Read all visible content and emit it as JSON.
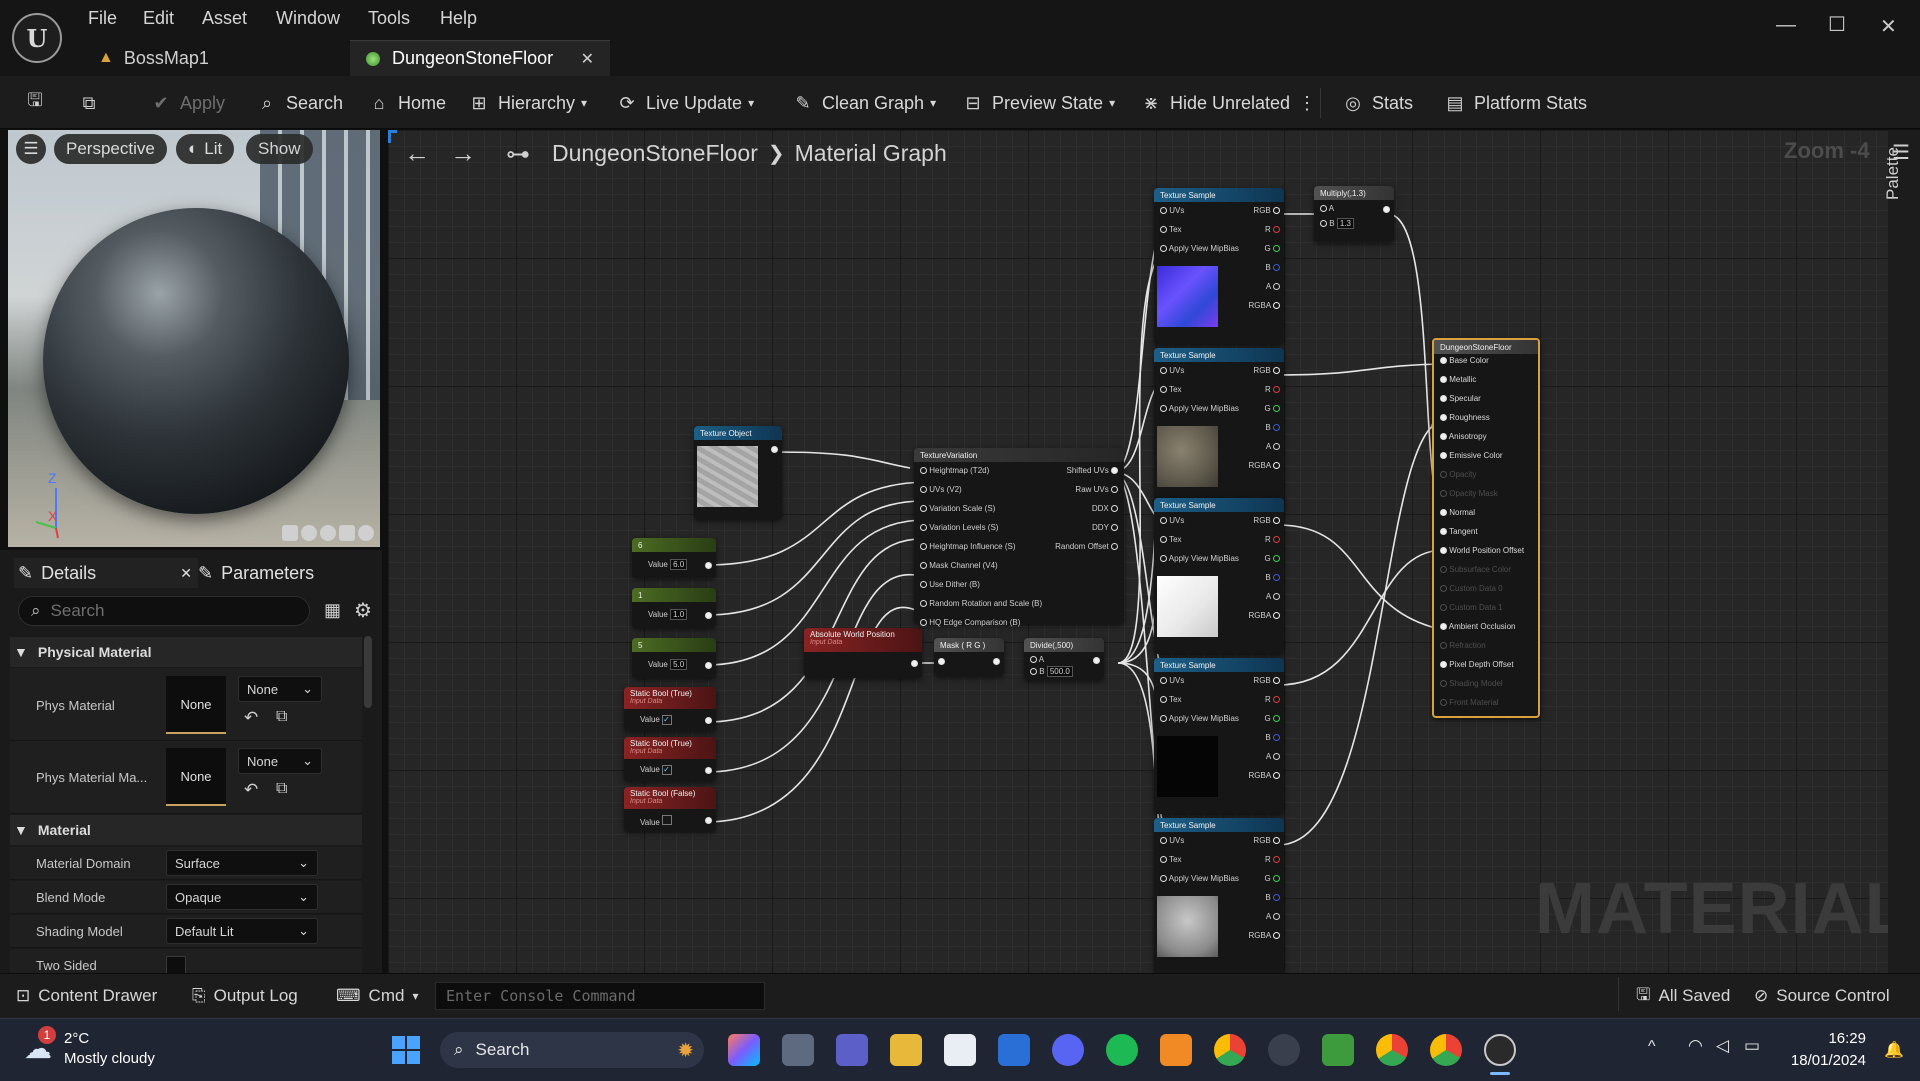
{
  "app": {
    "logo_text": "U",
    "menu": [
      "File",
      "Edit",
      "Asset",
      "Window",
      "Tools",
      "Help"
    ],
    "tabs": [
      {
        "label": "BossMap1",
        "active": false
      },
      {
        "label": "DungeonStoneFloor",
        "active": true
      }
    ]
  },
  "toolbar": {
    "apply": "Apply",
    "search": "Search",
    "home": "Home",
    "hierarchy": "Hierarchy",
    "live_update": "Live Update",
    "clean_graph": "Clean Graph",
    "preview_state": "Preview State",
    "hide_unrelated": "Hide Unrelated",
    "stats": "Stats",
    "platform_stats": "Platform Stats"
  },
  "viewport": {
    "perspective": "Perspective",
    "lit": "Lit",
    "show": "Show",
    "axis_z": "Z",
    "axis_x": "X"
  },
  "details": {
    "tab_details": "Details",
    "tab_parameters": "Parameters",
    "search_placeholder": "Search",
    "section_physical": "Physical Material",
    "phys_material": {
      "label": "Phys Material",
      "thumb": "None",
      "value": "None"
    },
    "phys_material_map": {
      "label": "Phys Material Ma...",
      "thumb": "None",
      "value": "None"
    },
    "section_material": "Material",
    "material_domain": {
      "label": "Material Domain",
      "value": "Surface"
    },
    "blend_mode": {
      "label": "Blend Mode",
      "value": "Opaque"
    },
    "shading_model": {
      "label": "Shading Model",
      "value": "Default Lit"
    },
    "two_sided": {
      "label": "Two Sided",
      "checked": false
    }
  },
  "graph": {
    "breadcrumb_asset": "DungeonStoneFloor",
    "breadcrumb_graph": "Material Graph",
    "zoom": "Zoom -4",
    "palette": "Palette",
    "watermark": "MATERIAL",
    "nodes": {
      "texture_sample_title": "Texture Sample",
      "ts_pins_in": [
        "UVs",
        "Tex",
        "Apply View MipBias"
      ],
      "ts_pins_out": [
        "RGB",
        "R",
        "G",
        "B",
        "A",
        "RGBA"
      ],
      "multiply": {
        "title": "Multiply(,1.3)",
        "pin_a": "A",
        "pin_b": "B",
        "b_value": "1.3"
      },
      "texture_object": "Texture Object",
      "texture_variation": {
        "title": "TextureVariation",
        "inputs": [
          "Heightmap (T2d)",
          "UVs (V2)",
          "Variation Scale (S)",
          "Variation Levels (S)",
          "Heightmap Influence (S)",
          "Mask Channel (V4)",
          "Use Dither (B)",
          "Random Rotation and Scale (B)",
          "HQ Edge Comparison (B)"
        ],
        "outputs": [
          "Shifted UVs",
          "Raw UVs",
          "DDX",
          "DDY",
          "Random Offset"
        ]
      },
      "constants": [
        {
          "title": "6",
          "value": "6.0"
        },
        {
          "title": "1",
          "value": "1.0"
        },
        {
          "title": "5",
          "value": "5.0"
        }
      ],
      "value_label": "Value",
      "static_bools": [
        {
          "title": "Static Bool (True)",
          "sub": "Input Data",
          "checked": true
        },
        {
          "title": "Static Bool (True)",
          "sub": "Input Data",
          "checked": true
        },
        {
          "title": "Static Bool (False)",
          "sub": "Input Data",
          "checked": false
        }
      ],
      "abs_world": {
        "title": "Absolute World Position",
        "sub": "Input Data"
      },
      "mask": "Mask ( R G )",
      "divide": {
        "title": "Divide(,500)",
        "pin_a": "A",
        "pin_b": "B",
        "b_value": "500.0"
      },
      "result": {
        "title": "DungeonStoneFloor",
        "pins": [
          {
            "label": "Base Color",
            "active": true
          },
          {
            "label": "Metallic",
            "active": true
          },
          {
            "label": "Specular",
            "active": true
          },
          {
            "label": "Roughness",
            "active": true
          },
          {
            "label": "Anisotropy",
            "active": true
          },
          {
            "label": "Emissive Color",
            "active": true
          },
          {
            "label": "Opacity",
            "active": false
          },
          {
            "label": "Opacity Mask",
            "active": false
          },
          {
            "label": "Normal",
            "active": true
          },
          {
            "label": "Tangent",
            "active": true
          },
          {
            "label": "World Position Offset",
            "active": true
          },
          {
            "label": "Subsurface Color",
            "active": false
          },
          {
            "label": "Custom Data 0",
            "active": false
          },
          {
            "label": "Custom Data 1",
            "active": false
          },
          {
            "label": "Ambient Occlusion",
            "active": true
          },
          {
            "label": "Refraction",
            "active": false
          },
          {
            "label": "Pixel Depth Offset",
            "active": true
          },
          {
            "label": "Shading Model",
            "active": false
          },
          {
            "label": "Front Material",
            "active": false
          }
        ]
      }
    }
  },
  "statusbar": {
    "content_drawer": "Content Drawer",
    "output_log": "Output Log",
    "cmd": "Cmd",
    "console_placeholder": "Enter Console Command",
    "all_saved": "All Saved",
    "source_control": "Source Control"
  },
  "taskbar": {
    "weather_temp": "2°C",
    "weather_desc": "Mostly cloudy",
    "weather_badge": "1",
    "search": "Search",
    "time": "16:29",
    "date": "18/01/2024"
  },
  "colors": {
    "accent_orange": "#d9a23a",
    "node_blue": "#1d5f87",
    "node_green": "#4c6c23",
    "node_red": "#8a2323"
  }
}
